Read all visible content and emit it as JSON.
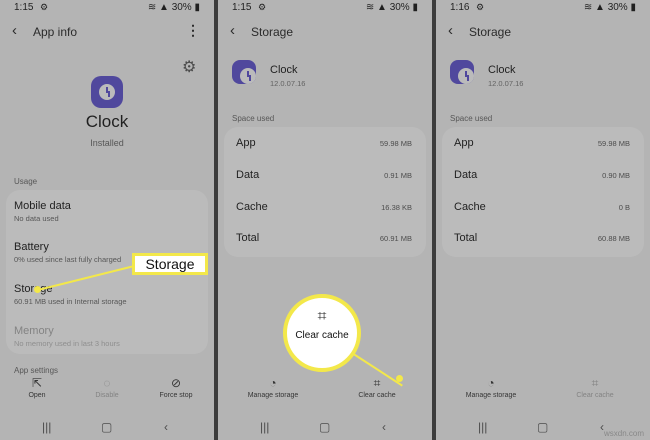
{
  "status_bar": {
    "panel1_time": "1:15",
    "panel2_time": "1:15",
    "panel3_time": "1:16",
    "battery": "30%"
  },
  "panel1": {
    "title": "App info",
    "app_name": "Clock",
    "app_status": "Installed",
    "usage_section": "Usage",
    "items": [
      {
        "title": "Mobile data",
        "subtitle": "No data used"
      },
      {
        "title": "Battery",
        "subtitle": "0% used since last fully charged"
      },
      {
        "title": "Storage",
        "subtitle": "60.91 MB used in Internal storage"
      },
      {
        "title": "Memory",
        "subtitle": "No memory used in last 3 hours"
      }
    ],
    "app_settings_section": "App settings",
    "actions": [
      {
        "label": "Open",
        "icon": "open-external-icon"
      },
      {
        "label": "Disable",
        "icon": "disable-icon"
      },
      {
        "label": "Force stop",
        "icon": "force-stop-icon"
      }
    ],
    "callout": "Storage"
  },
  "panel2": {
    "title": "Storage",
    "app_name": "Clock",
    "version": "12.0.07.16",
    "section": "Space used",
    "rows": [
      {
        "label": "App",
        "value": "59.98 MB"
      },
      {
        "label": "Data",
        "value": "0.91 MB"
      },
      {
        "label": "Cache",
        "value": "16.38 KB"
      },
      {
        "label": "Total",
        "value": "60.91 MB"
      }
    ],
    "actions": [
      {
        "label": "Manage storage",
        "icon": "pie-chart-icon"
      },
      {
        "label": "Clear cache",
        "icon": "broom-icon"
      }
    ],
    "spotlight_label": "Clear cache"
  },
  "panel3": {
    "title": "Storage",
    "app_name": "Clock",
    "version": "12.0.07.16",
    "section": "Space used",
    "rows": [
      {
        "label": "App",
        "value": "59.98 MB"
      },
      {
        "label": "Data",
        "value": "0.90 MB"
      },
      {
        "label": "Cache",
        "value": "0 B"
      },
      {
        "label": "Total",
        "value": "60.88 MB"
      }
    ],
    "actions": [
      {
        "label": "Manage storage",
        "icon": "pie-chart-icon"
      },
      {
        "label": "Clear cache",
        "icon": "broom-icon"
      }
    ]
  },
  "watermark": "wsxdn.com",
  "colors": {
    "accent": "#5b4fd1",
    "highlight": "#f3e84a"
  }
}
